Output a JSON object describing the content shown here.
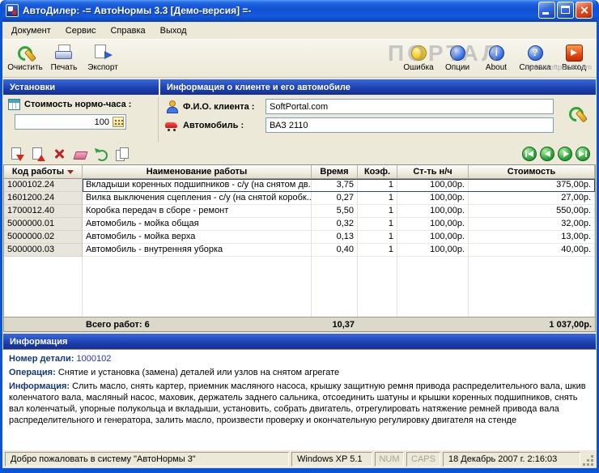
{
  "window": {
    "title": "АвтоДилер: -= АвтоНормы 3.3 [Демо-версия] =-"
  },
  "menu": {
    "items": [
      {
        "label": "Документ",
        "name": "menu-item-document"
      },
      {
        "label": "Сервис",
        "name": "menu-item-service"
      },
      {
        "label": "Справка",
        "name": "menu-item-help"
      },
      {
        "label": "Выход",
        "name": "menu-item-exit"
      }
    ]
  },
  "toolbar": {
    "left": [
      {
        "label": "Очистить",
        "name": "clear-button",
        "icon": "clear-icon"
      },
      {
        "label": "Печать",
        "name": "print-button",
        "icon": "print-icon"
      },
      {
        "label": "Экспорт",
        "name": "export-button",
        "icon": "export-icon"
      }
    ],
    "right": [
      {
        "label": "Ошибка",
        "name": "error-button",
        "icon": "error-icon"
      },
      {
        "label": "Опции",
        "name": "options-button",
        "icon": "options-icon"
      },
      {
        "label": "About",
        "name": "about-button",
        "icon": "about-icon"
      },
      {
        "label": "Справка",
        "name": "help-button",
        "icon": "help-icon"
      },
      {
        "label": "Выход",
        "name": "exit-button",
        "icon": "exit-icon"
      }
    ],
    "watermark": "ПОРТАЛ",
    "watermark_url": "www.softportal.com"
  },
  "panels": {
    "settings": {
      "title": "Установки",
      "rate_label": "Стоимость нормо-часа :",
      "rate_value": "100"
    },
    "client": {
      "title": "Информация о клиенте и его автомобиле",
      "name_label": "Ф.И.О. клиента :",
      "name_value": "SoftPortal.com",
      "car_label": "Автомобиль :",
      "car_value": "ВАЗ 2110"
    }
  },
  "minibar": {
    "buttons": [
      {
        "name": "add-work-button",
        "icon": "add-doc-icon"
      },
      {
        "name": "insert-work-button",
        "icon": "insert-doc-icon"
      },
      {
        "name": "delete-work-button",
        "icon": "delete-icon"
      },
      {
        "name": "erase-works-button",
        "icon": "eraser-icon"
      },
      {
        "name": "refresh-button",
        "icon": "refresh-icon"
      },
      {
        "name": "copy-button",
        "icon": "copy-icon"
      }
    ],
    "nav": [
      {
        "name": "nav-first-button",
        "icon": "nav-first-icon"
      },
      {
        "name": "nav-prev-button",
        "icon": "nav-prev-icon"
      },
      {
        "name": "nav-next-button",
        "icon": "nav-next-icon"
      },
      {
        "name": "nav-last-button",
        "icon": "nav-last-icon"
      }
    ]
  },
  "table": {
    "headers": [
      "Код работы",
      "Наименование работы",
      "Время",
      "Коэф.",
      "Ст-ть н/ч",
      "Стоимость"
    ],
    "sort_column": 0,
    "selected_row_index": 0,
    "rows": [
      {
        "code": "1000102.24",
        "name": "Вкладыши коренных подшипников - с/у (на снятом дв...",
        "time": "3,75",
        "coef": "1",
        "rate": "100,00р.",
        "cost": "375,00р."
      },
      {
        "code": "1601200.24",
        "name": "Вилка выключения сцепления - с/у (на снятой коробк...",
        "time": "0,27",
        "coef": "1",
        "rate": "100,00р.",
        "cost": "27,00р."
      },
      {
        "code": "1700012.40",
        "name": "Коробка передач в сборе - ремонт",
        "time": "5,50",
        "coef": "1",
        "rate": "100,00р.",
        "cost": "550,00р."
      },
      {
        "code": "5000000.01",
        "name": "Автомобиль - мойка общая",
        "time": "0,32",
        "coef": "1",
        "rate": "100,00р.",
        "cost": "32,00р."
      },
      {
        "code": "5000000.02",
        "name": "Автомобиль - мойка верха",
        "time": "0,13",
        "coef": "1",
        "rate": "100,00р.",
        "cost": "13,00р."
      },
      {
        "code": "5000000.03",
        "name": "Автомобиль - внутренняя уборка",
        "time": "0,40",
        "coef": "1",
        "rate": "100,00р.",
        "cost": "40,00р."
      }
    ],
    "footer": {
      "label": "Всего работ: 6",
      "time": "10,37",
      "cost": "1 037,00р."
    }
  },
  "info": {
    "title": "Информация",
    "part_label": "Номер детали:",
    "part_value": "1000102",
    "operation_label": "Операция:",
    "operation_text": "Снятие и установка (замена) деталей или узлов на снятом агрегате",
    "info_label": "Информация:",
    "info_text": "Слить масло, снять картер, приемник масляного насоса, крышку защитную ремня привода распределительного вала, шкив коленчатого вала, масляный насос, маховик, держатель заднего сальника, отсоединить шатуны и крышки коренных подшипников, снять вал коленчатый, упорные полукольца и вкладыши, установить, собрать двигатель, отрегулировать натяжение ремней привода вала распределительного и генератора, залить масло, произвести проверку и окончательную регулировку двигателя на стенде"
  },
  "statusbar": {
    "welcome": "Добро пожаловать в систему \"АвтоНормы 3\"",
    "os": "Windows XP 5.1",
    "num": "NUM",
    "caps": "CAPS",
    "datetime": "18 Декабрь 2007 г. 2:16:03"
  }
}
